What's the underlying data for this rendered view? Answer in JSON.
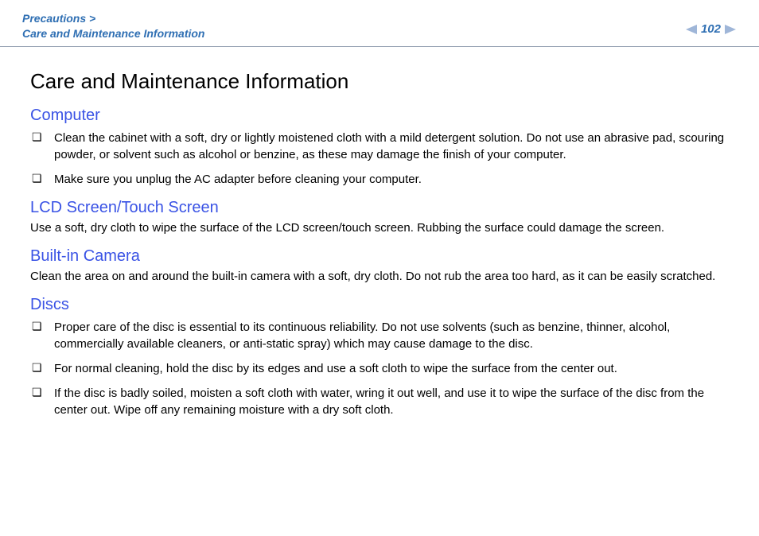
{
  "header": {
    "breadcrumb_line1": "Precautions >",
    "breadcrumb_line2": "Care and Maintenance Information",
    "page_number": "102"
  },
  "title": "Care and Maintenance Information",
  "sections": {
    "computer": {
      "heading": "Computer",
      "items": [
        "Clean the cabinet with a soft, dry or lightly moistened cloth with a mild detergent solution. Do not use an abrasive pad, scouring powder, or solvent such as alcohol or benzine, as these may damage the finish of your computer.",
        "Make sure you unplug the AC adapter before cleaning your computer."
      ]
    },
    "lcd": {
      "heading": "LCD Screen/Touch Screen",
      "text": "Use a soft, dry cloth to wipe the surface of the LCD screen/touch screen. Rubbing the surface could damage the screen."
    },
    "camera": {
      "heading": "Built-in Camera",
      "text": "Clean the area on and around the built-in camera with a soft, dry cloth. Do not rub the area too hard, as it can be easily scratched."
    },
    "discs": {
      "heading": "Discs",
      "items": [
        "Proper care of the disc is essential to its continuous reliability. Do not use solvents (such as benzine, thinner, alcohol, commercially available cleaners, or anti-static spray) which may cause damage to the disc.",
        "For normal cleaning, hold the disc by its edges and use a soft cloth to wipe the surface from the center out.",
        "If the disc is badly soiled, moisten a soft cloth with water, wring it out well, and use it to wipe the surface of the disc from the center out. Wipe off any remaining moisture with a dry soft cloth."
      ]
    }
  }
}
